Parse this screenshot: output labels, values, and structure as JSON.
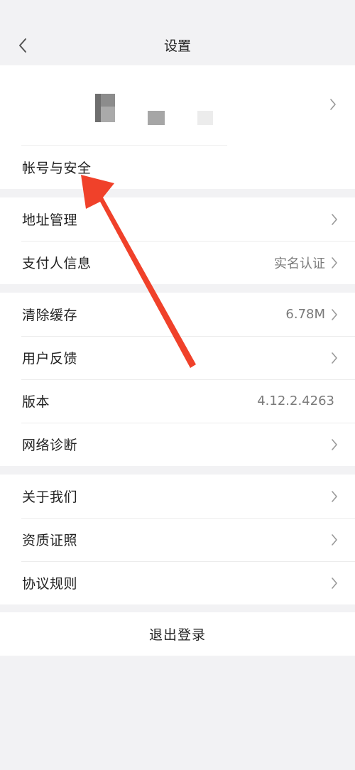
{
  "header": {
    "title": "设置"
  },
  "profile": {
    "account_security_label": "帐号与安全"
  },
  "group1": {
    "address_label": "地址管理",
    "payer_label": "支付人信息",
    "payer_value": "实名认证"
  },
  "group2": {
    "clear_cache_label": "清除缓存",
    "clear_cache_value": "6.78M",
    "feedback_label": "用户反馈",
    "version_label": "版本",
    "version_value": "4.12.2.4263",
    "network_label": "网络诊断"
  },
  "group3": {
    "about_label": "关于我们",
    "qualification_label": "资质证照",
    "agreement_label": "协议规则"
  },
  "logout": {
    "label": "退出登录"
  },
  "colors": {
    "background": "#f2f2f4",
    "card": "#ffffff",
    "secondary_text": "#7a7a7a",
    "annotation_arrow": "#f0412a"
  },
  "icons": {
    "back": "chevron-left-icon",
    "row_arrow": "chevron-right-icon"
  }
}
